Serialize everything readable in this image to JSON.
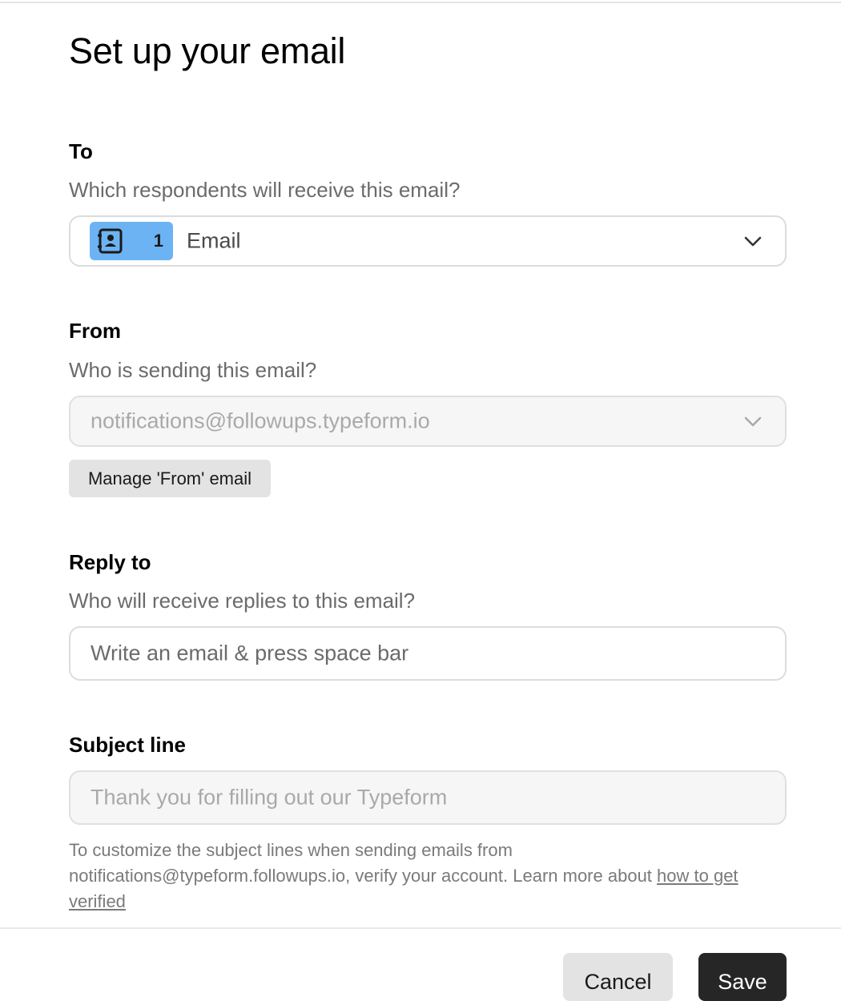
{
  "page": {
    "title": "Set up your email"
  },
  "to": {
    "label": "To",
    "description": "Which respondents will receive this email?",
    "chip_icon": "contact-card-icon",
    "chip_number": "1",
    "value": "Email",
    "chip_color": "#6cb3f3"
  },
  "from": {
    "label": "From",
    "description": "Who is sending this email?",
    "value": "notifications@followups.typeform.io",
    "manage_button": "Manage 'From' email"
  },
  "reply_to": {
    "label": "Reply to",
    "description": "Who will receive replies to this email?",
    "placeholder": "Write an email & press space bar"
  },
  "subject": {
    "label": "Subject line",
    "placeholder": "Thank you for filling out our Typeform",
    "help_text": "To customize the subject lines when sending emails from notifications@typeform.followups.io, verify your account. Learn more about ",
    "help_link": "how to get verified"
  },
  "footer": {
    "cancel": "Cancel",
    "save": "Save",
    "save_color": "#262627"
  }
}
